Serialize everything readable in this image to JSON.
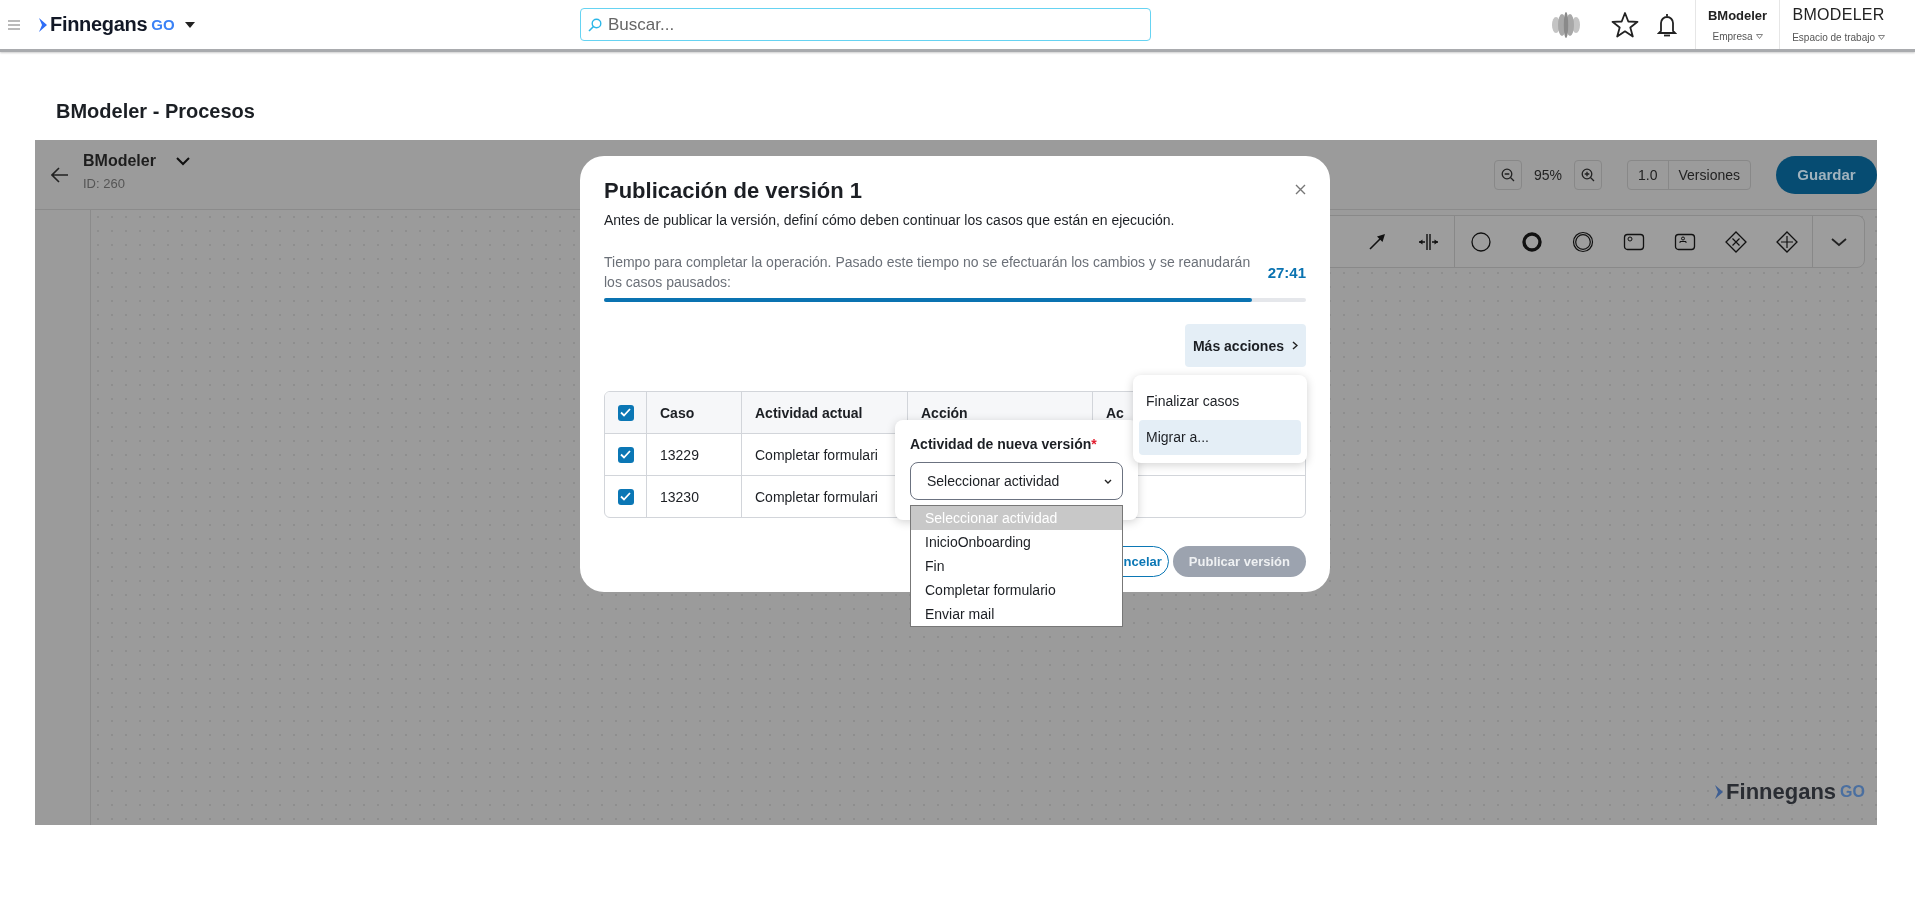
{
  "topbar": {
    "logo": {
      "name": "Finnegans",
      "suffix": "GO"
    },
    "search": {
      "placeholder": "Buscar..."
    },
    "company": {
      "value": "BModeler",
      "label": "Empresa"
    },
    "workspace": {
      "value": "BMODELER",
      "label": "Espacio de trabajo"
    }
  },
  "page_title": "BModeler - Procesos",
  "editor": {
    "process_name": "BModeler",
    "process_id": "ID: 260",
    "zoom": "95%",
    "version": "1.0",
    "versions_button": "Versiones",
    "save_button": "Guardar",
    "footer_logo": {
      "name": "Finnegans",
      "suffix": "GO"
    }
  },
  "dialog": {
    "title": "Publicación de versión 1",
    "subtitle": "Antes de publicar la versión, definí cómo deben continuar los casos que están en ejecución.",
    "timer_text": "Tiempo para completar la operación. Pasado este tiempo no se efectuarán los cambios y se reanudarán los casos pausados:",
    "timer": "27:41",
    "progress": {
      "level": 0.923
    },
    "more_actions": "Más acciones",
    "menu": [
      {
        "label": "Finalizar casos",
        "selected": false
      },
      {
        "label": "Migrar a...",
        "selected": true
      }
    ],
    "table": {
      "header_checked": true,
      "columns": [
        "Caso",
        "Actividad actual",
        "Acción",
        "Ac"
      ],
      "rows": [
        {
          "checked": true,
          "case": "13229",
          "activity": "Completar formulari"
        },
        {
          "checked": true,
          "case": "13230",
          "activity": "Completar formulari"
        }
      ]
    },
    "popover": {
      "label": "Actividad de nueva versión",
      "required_mark": "*",
      "value": "Seleccionar actividad",
      "options": [
        {
          "label": "Seleccionar actividad",
          "selected": true
        },
        {
          "label": "InicioOnboarding",
          "selected": false
        },
        {
          "label": "Fin",
          "selected": false
        },
        {
          "label": "Completar formulario",
          "selected": false
        },
        {
          "label": "Enviar mail",
          "selected": false
        }
      ]
    },
    "buttons": [
      {
        "label": "ncelar",
        "kind": "outline",
        "disabled": false
      },
      {
        "label": "Publicar versión",
        "kind": "primary",
        "disabled": true
      }
    ]
  }
}
